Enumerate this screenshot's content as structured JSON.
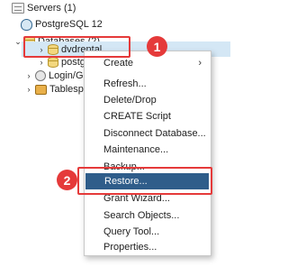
{
  "tree": {
    "servers": "Servers (1)",
    "server": "PostgreSQL 12",
    "databases": "Databases (2)",
    "db_selected": "dvdrental",
    "db_other": "postgres",
    "login": "Login/Group Roles",
    "tablespaces": "Tablespaces"
  },
  "context_menu": {
    "create": "Create",
    "refresh": "Refresh...",
    "delete": "Delete/Drop",
    "create_script": "CREATE Script",
    "disconnect": "Disconnect Database...",
    "maintenance": "Maintenance...",
    "backup": "Backup...",
    "restore": "Restore...",
    "grant": "Grant Wizard...",
    "search": "Search Objects...",
    "query": "Query Tool...",
    "properties": "Properties..."
  },
  "callouts": {
    "step1": "1",
    "step2": "2"
  },
  "colors": {
    "callout": "#e53a3a",
    "selection": "#d4e7f5",
    "menu_highlight": "#2f5d8a"
  }
}
